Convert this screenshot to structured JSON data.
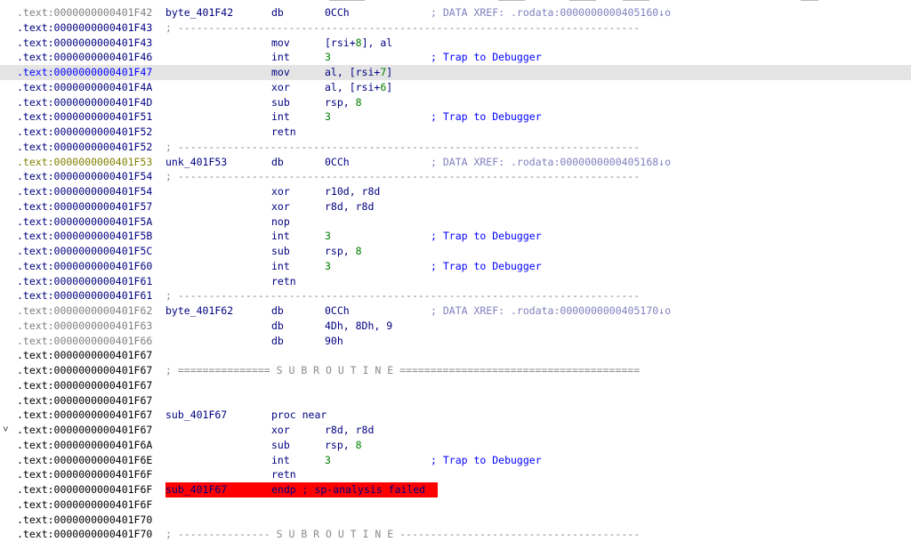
{
  "rows": [
    {
      "addr": ".text:0000000000401F42",
      "kind": "gray",
      "label": "byte_401F42",
      "mnem": "db",
      "ops": "0CCh",
      "comment": "; DATA XREF: .rodata:0000000000405160↓o",
      "ctype": "x"
    },
    {
      "addr": ".text:0000000000401F43",
      "kind": "blue",
      "sep": "; ---------------------------------------------------------------------------"
    },
    {
      "addr": ".text:0000000000401F43",
      "kind": "blue",
      "mnem": "mov",
      "ops": "[rsi+",
      "num": "8",
      "ops2": "], al"
    },
    {
      "addr": ".text:0000000000401F46",
      "kind": "blue",
      "mnem": "int",
      "num": "3",
      "comment": "; Trap to Debugger"
    },
    {
      "addr": ".text:0000000000401F47",
      "kind": "sel",
      "mnem": "mov",
      "ops": "al, [rsi+",
      "num": "7",
      "ops2": "]"
    },
    {
      "addr": ".text:0000000000401F4A",
      "kind": "blue",
      "mnem": "xor",
      "ops": "al, [rsi+",
      "num": "6",
      "ops2": "]"
    },
    {
      "addr": ".text:0000000000401F4D",
      "kind": "blue",
      "mnem": "sub",
      "ops": "rsp, ",
      "num": "8"
    },
    {
      "addr": ".text:0000000000401F51",
      "kind": "blue",
      "mnem": "int",
      "num": "3",
      "comment": "; Trap to Debugger"
    },
    {
      "addr": ".text:0000000000401F52",
      "kind": "blue",
      "mnem": "retn"
    },
    {
      "addr": ".text:0000000000401F52",
      "kind": "blue",
      "sep": "; ---------------------------------------------------------------------------"
    },
    {
      "addr": ".text:0000000000401F53",
      "kind": "olive",
      "label": "unk_401F53",
      "mnem": "db",
      "ops": "0CCh",
      "comment": "; DATA XREF: .rodata:0000000000405168↓o",
      "ctype": "x"
    },
    {
      "addr": ".text:0000000000401F54",
      "kind": "blue",
      "sep": "; ---------------------------------------------------------------------------"
    },
    {
      "addr": ".text:0000000000401F54",
      "kind": "blue",
      "mnem": "xor",
      "ops": "r10d, r8d"
    },
    {
      "addr": ".text:0000000000401F57",
      "kind": "blue",
      "mnem": "xor",
      "ops": "r8d, r8d"
    },
    {
      "addr": ".text:0000000000401F5A",
      "kind": "blue",
      "mnem": "nop"
    },
    {
      "addr": ".text:0000000000401F5B",
      "kind": "blue",
      "mnem": "int",
      "num": "3",
      "comment": "; Trap to Debugger"
    },
    {
      "addr": ".text:0000000000401F5C",
      "kind": "blue",
      "mnem": "sub",
      "ops": "rsp, ",
      "num": "8"
    },
    {
      "addr": ".text:0000000000401F60",
      "kind": "blue",
      "mnem": "int",
      "num": "3",
      "comment": "; Trap to Debugger"
    },
    {
      "addr": ".text:0000000000401F61",
      "kind": "blue",
      "mnem": "retn"
    },
    {
      "addr": ".text:0000000000401F61",
      "kind": "blue",
      "sep": "; ---------------------------------------------------------------------------"
    },
    {
      "addr": ".text:0000000000401F62",
      "kind": "gray",
      "label": "byte_401F62",
      "mnem": "db",
      "ops": "0CCh",
      "comment": "; DATA XREF: .rodata:0000000000405170↓o",
      "ctype": "x"
    },
    {
      "addr": ".text:0000000000401F63",
      "kind": "gray",
      "mnem": "db",
      "ops": "4Dh, 8Dh, 9"
    },
    {
      "addr": ".text:0000000000401F66",
      "kind": "gray",
      "mnem": "db",
      "ops": "90h"
    },
    {
      "addr": ".text:0000000000401F67",
      "kind": "black"
    },
    {
      "addr": ".text:0000000000401F67",
      "kind": "black",
      "sep": "; =============== S U B R O U T I N E ======================================="
    },
    {
      "addr": ".text:0000000000401F67",
      "kind": "black"
    },
    {
      "addr": ".text:0000000000401F67",
      "kind": "black"
    },
    {
      "addr": ".text:0000000000401F67",
      "kind": "black",
      "label": "sub_401F67",
      "mnem": "proc near"
    },
    {
      "addr": ".text:0000000000401F67",
      "kind": "black",
      "arrow": "˅",
      "mnem": "xor",
      "ops": "r8d, r8d"
    },
    {
      "addr": ".text:0000000000401F6A",
      "kind": "black",
      "mnem": "sub",
      "ops": "rsp, ",
      "num": "8"
    },
    {
      "addr": ".text:0000000000401F6E",
      "kind": "black",
      "mnem": "int",
      "num": "3",
      "comment": "; Trap to Debugger"
    },
    {
      "addr": ".text:0000000000401F6F",
      "kind": "black",
      "mnem": "retn"
    },
    {
      "addr": ".text:0000000000401F6F",
      "kind": "black",
      "label": "sub_401F67",
      "red": true,
      "endp": "endp ; sp-analysis failed"
    },
    {
      "addr": ".text:0000000000401F6F",
      "kind": "black"
    },
    {
      "addr": ".text:0000000000401F70",
      "kind": "black"
    },
    {
      "addr": ".text:0000000000401F70",
      "kind": "black",
      "sep": "; --------------- S U B R O U T I N E ---------------------------------------"
    }
  ]
}
